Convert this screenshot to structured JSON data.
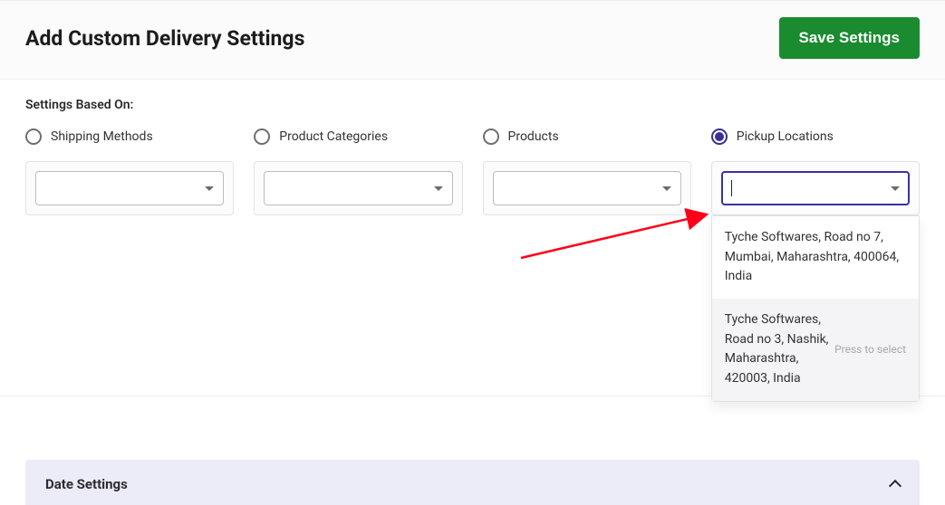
{
  "header": {
    "title": "Add Custom Delivery Settings",
    "save_label": "Save Settings"
  },
  "settings": {
    "based_on_label": "Settings Based On:",
    "options": [
      {
        "label": "Shipping Methods",
        "selected": false
      },
      {
        "label": "Product Categories",
        "selected": false
      },
      {
        "label": "Products",
        "selected": false
      },
      {
        "label": "Pickup Locations",
        "selected": true
      }
    ]
  },
  "dropdown": {
    "options": [
      {
        "text": "Tyche Softwares, Road no 7, Mumbai, Maharashtra, 400064, India"
      },
      {
        "text": "Tyche Softwares, Road no 3, Nashik, Maharashtra, 420003, India"
      }
    ],
    "press_hint": "Press to select"
  },
  "accordion": {
    "date_settings_label": "Date Settings"
  }
}
